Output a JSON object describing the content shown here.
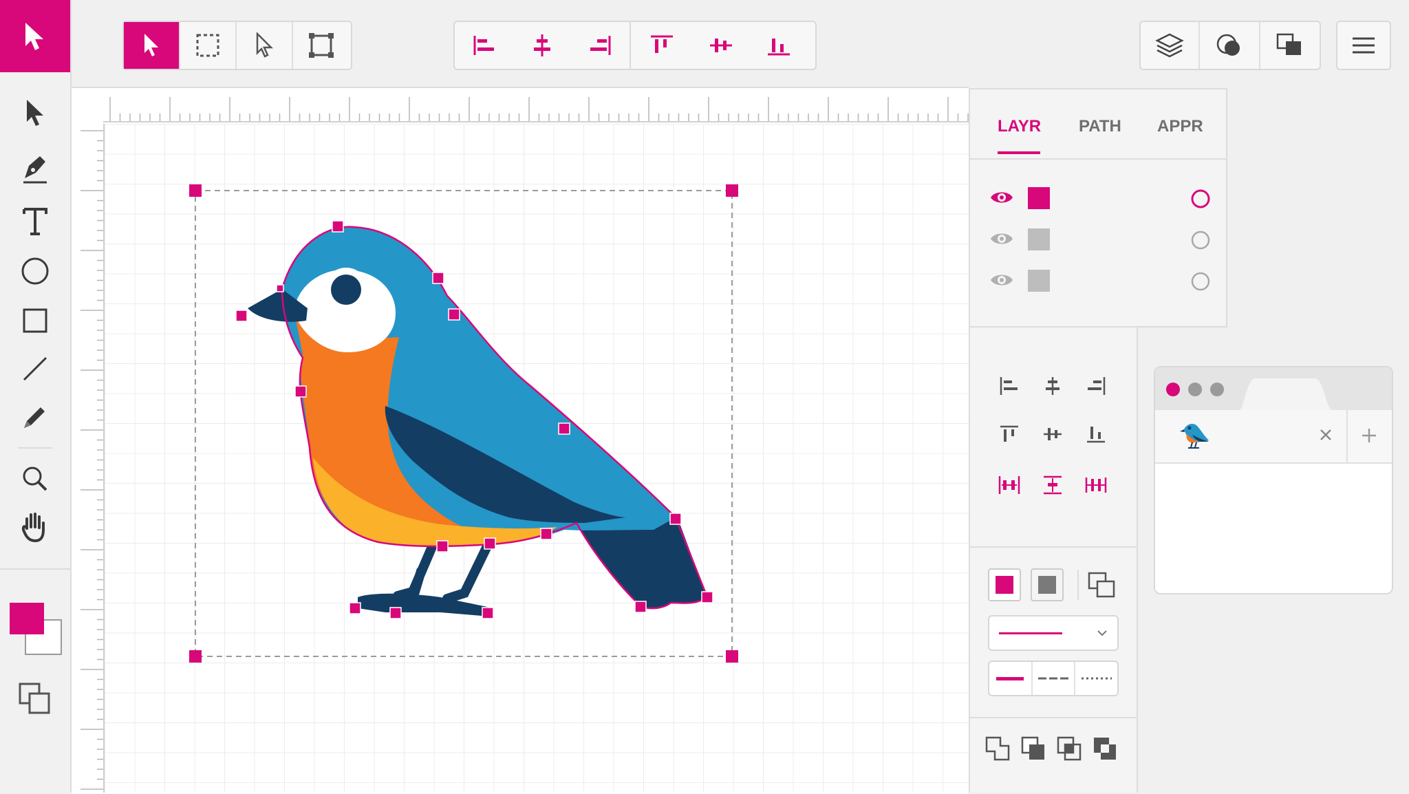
{
  "panel": {
    "tabs": [
      {
        "label": "LAYR"
      },
      {
        "label": "PATH"
      },
      {
        "label": "APPR"
      }
    ]
  },
  "colors": {
    "accent": "#d8077a",
    "toolbar_bg": "#f1f1f1",
    "panel_bg": "#f4f4f4",
    "canvas_bg": "#ffffff",
    "bird_blue": "#2596c8",
    "bird_navy": "#143d64",
    "bird_orange": "#f47920",
    "bird_yellow": "#fbb12a"
  },
  "left_toolbar": {
    "tools": [
      "select-arrow-icon",
      "pen-icon",
      "text-icon",
      "ellipse-icon",
      "rectangle-icon",
      "line-icon",
      "pencil-icon",
      "zoom-icon",
      "hand-icon"
    ],
    "fill_color": "#d8077a",
    "stroke_color": "#ffffff"
  },
  "top_toolbar": {
    "selection_tools": [
      "selection-arrow-icon",
      "marquee-icon",
      "direct-select-icon",
      "transform-icon"
    ],
    "align_tools": [
      "align-left-icon",
      "align-center-h-icon",
      "align-right-icon",
      "align-top-icon",
      "align-middle-v-icon",
      "align-bottom-icon"
    ],
    "right_tools": [
      "layers-icon",
      "shapes-icon",
      "arrange-icon",
      "menu-icon"
    ]
  },
  "layers": [
    {
      "visible_icon": "eye-icon",
      "swatch": "#d8077a",
      "active": true
    },
    {
      "visible_icon": "eye-icon",
      "swatch": "#bdbdbd",
      "active": false
    },
    {
      "visible_icon": "eye-icon",
      "swatch": "#bdbdbd",
      "active": false
    }
  ],
  "stroke": {
    "line_styles": [
      "solid-line-icon",
      "dashed-line-icon",
      "dotted-line-icon"
    ]
  },
  "browser": {
    "tab_icon": "bird-favicon-icon"
  }
}
